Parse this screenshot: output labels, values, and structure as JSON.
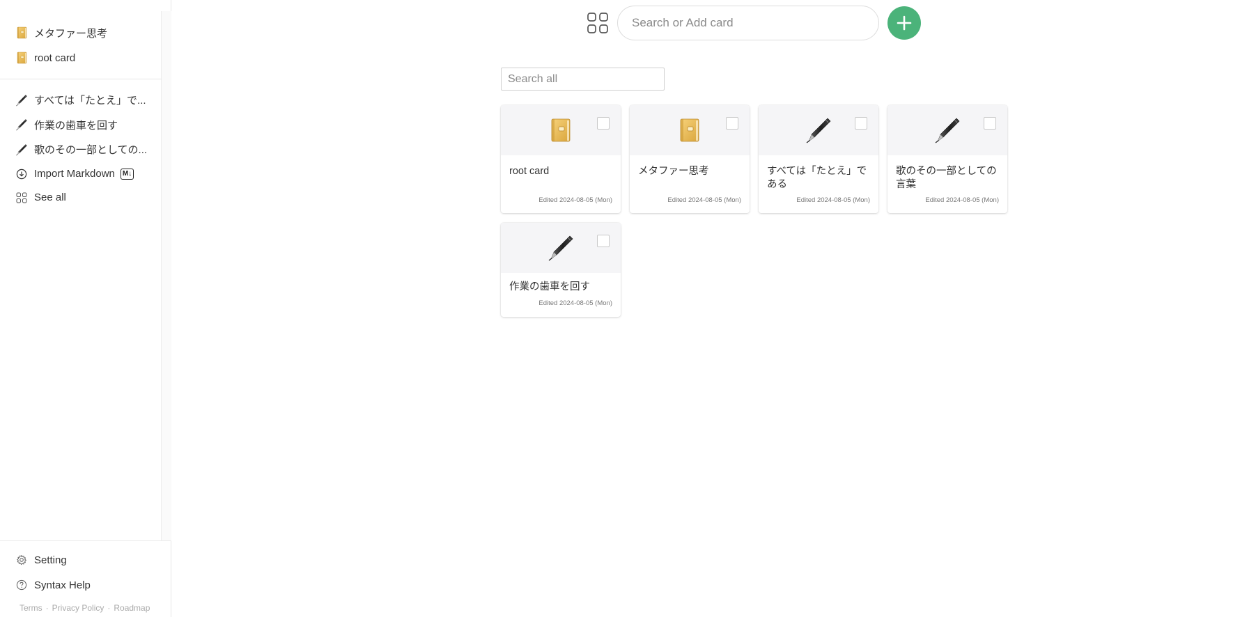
{
  "sidebar": {
    "pinned": [
      {
        "label": "メタファー思考",
        "icon": "notebook-icon"
      },
      {
        "label": "root card",
        "icon": "notebook-icon"
      }
    ],
    "recent": [
      {
        "label": "すべては「たとえ」で...",
        "icon": "pen-icon"
      },
      {
        "label": "作業の歯車を回す",
        "icon": "pen-icon"
      },
      {
        "label": "歌のその一部としての...",
        "icon": "pen-icon"
      }
    ],
    "import_label": "Import Markdown",
    "import_badge": "M↓",
    "see_all_label": "See all",
    "setting_label": "Setting",
    "syntax_help_label": "Syntax Help",
    "footer": {
      "terms": "Terms",
      "privacy": "Privacy Policy",
      "roadmap": "Roadmap",
      "separator": "·"
    }
  },
  "topbar": {
    "search_placeholder": "Search or Add card",
    "add_icon": "plus-icon",
    "add_color": "#4bb37a"
  },
  "search_all": {
    "placeholder": "Search all"
  },
  "cards": [
    {
      "title": "root card",
      "edited": "Edited 2024-08-05 (Mon)",
      "icon": "notebook-icon"
    },
    {
      "title": "メタファー思考",
      "edited": "Edited 2024-08-05 (Mon)",
      "icon": "notebook-icon"
    },
    {
      "title": "すべては「たとえ」である",
      "edited": "Edited 2024-08-05 (Mon)",
      "icon": "pen-icon"
    },
    {
      "title": "歌のその一部としての言葉",
      "edited": "Edited 2024-08-05 (Mon)",
      "icon": "pen-icon"
    },
    {
      "title": "作業の歯車を回す",
      "edited": "Edited 2024-08-05 (Mon)",
      "icon": "pen-icon"
    }
  ]
}
